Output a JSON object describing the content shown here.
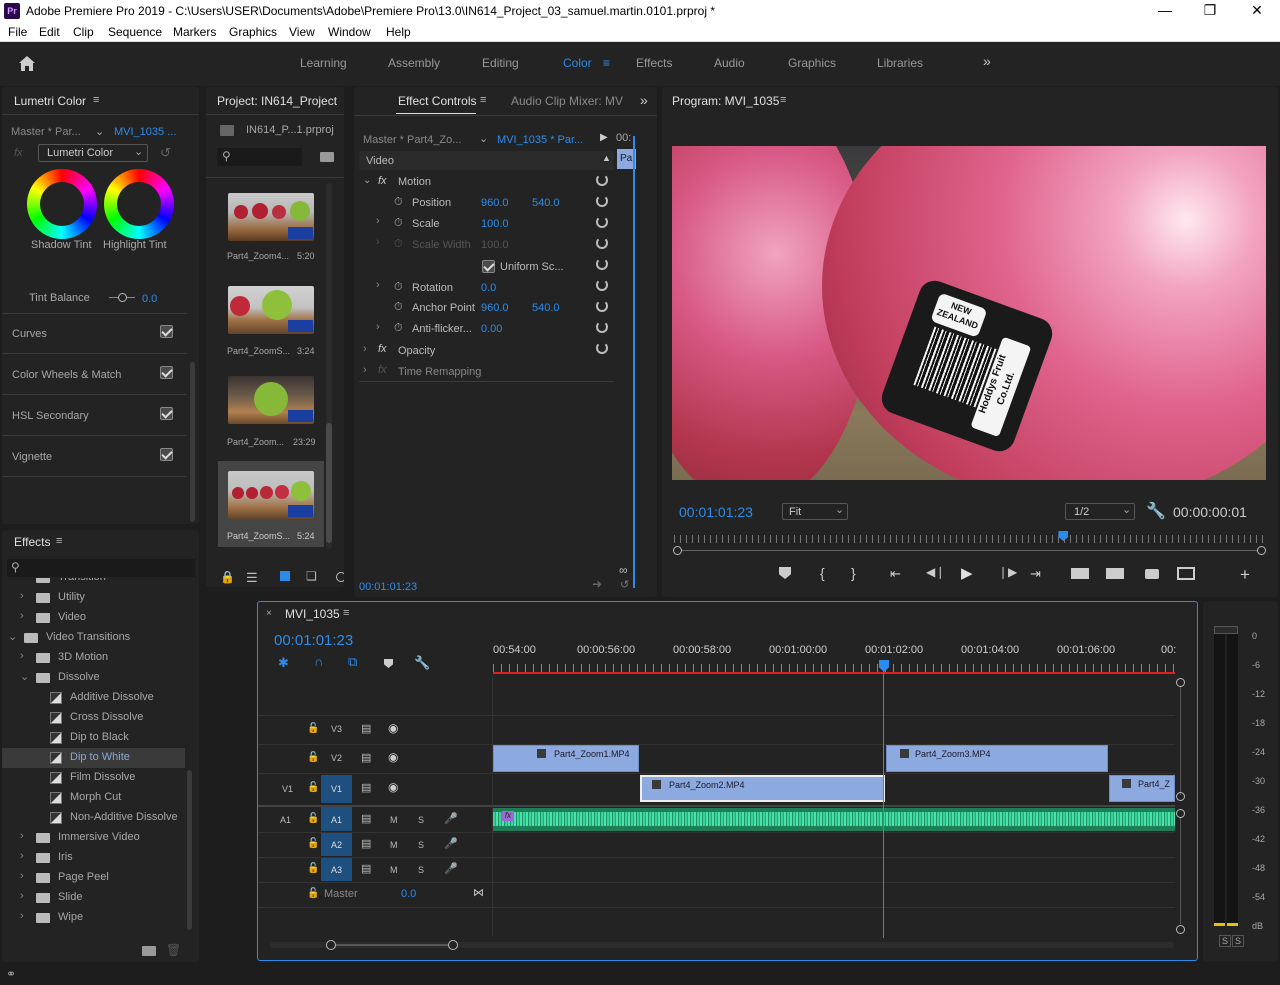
{
  "window": {
    "title": "Adobe Premiere Pro 2019 - C:\\Users\\USER\\Documents\\Adobe\\Premiere Pro\\13.0\\IN614_Project_03_samuel.martin.0101.prproj *",
    "app_icon": "Pr"
  },
  "menu": [
    "File",
    "Edit",
    "Clip",
    "Sequence",
    "Markers",
    "Graphics",
    "View",
    "Window",
    "Help"
  ],
  "workspaces": [
    "Learning",
    "Assembly",
    "Editing",
    "Color",
    "Effects",
    "Audio",
    "Graphics",
    "Libraries"
  ],
  "active_workspace": "Color",
  "lumetri": {
    "title": "Lumetri Color",
    "master": "Master * Par...",
    "clip": "MVI_1035 ...",
    "effect_select": "Lumetri Color",
    "wheel1": "Shadow Tint",
    "wheel2": "Highlight Tint",
    "tint_balance_label": "Tint Balance",
    "tint_balance_value": "0.0",
    "sections": [
      "Curves",
      "Color Wheels & Match",
      "HSL Secondary",
      "Vignette"
    ]
  },
  "project": {
    "title": "Project: IN614_Project",
    "file": "IN614_P...1.prproj",
    "clips": [
      {
        "name": "Part4_Zoom4...",
        "duration": "5:20"
      },
      {
        "name": "Part4_ZoomS...",
        "duration": "3:24"
      },
      {
        "name": "Part4_Zoom...",
        "duration": "23:29"
      },
      {
        "name": "Part4_ZoomS...",
        "duration": "5:24"
      }
    ]
  },
  "effect_controls": {
    "tab1": "Effect Controls",
    "tab2": "Audio Clip Mixer: MV",
    "master": "Master * Part4_Zo...",
    "clip": "MVI_1035 * Par...",
    "time_label": "00:",
    "clip_marker": "Pa",
    "section": "Video",
    "motion": "Motion",
    "position_label": "Position",
    "position_x": "960.0",
    "position_y": "540.0",
    "scale_label": "Scale",
    "scale_value": "100.0",
    "scale_width_label": "Scale Width",
    "scale_width_value": "100.0",
    "uniform_label": "Uniform Sc...",
    "rotation_label": "Rotation",
    "rotation_value": "0.0",
    "anchor_label": "Anchor Point",
    "anchor_x": "960.0",
    "anchor_y": "540.0",
    "antiflicker_label": "Anti-flicker...",
    "antiflicker_value": "0.00",
    "opacity": "Opacity",
    "time_remap": "Time Remapping",
    "timecode": "00:01:01:23"
  },
  "program": {
    "title": "Program: MVI_1035",
    "timecode": "00:01:01:23",
    "fit": "Fit",
    "resolution": "1/2",
    "duration": "00:00:00:01",
    "playhead_pos": 0.66,
    "sticker_line1": "NEW",
    "sticker_line2": "ZEALAND",
    "sticker_brand": "Hoddys Fruit Co.Ltd."
  },
  "effects": {
    "title": "Effects",
    "items": [
      {
        "label": "Transition",
        "level": 1,
        "type": "folder"
      },
      {
        "label": "Utility",
        "level": 1,
        "type": "folder"
      },
      {
        "label": "Video",
        "level": 1,
        "type": "folder"
      },
      {
        "label": "Video Transitions",
        "level": 0,
        "type": "folder"
      },
      {
        "label": "3D Motion",
        "level": 1,
        "type": "folder"
      },
      {
        "label": "Dissolve",
        "level": 1,
        "type": "folder"
      },
      {
        "label": "Additive Dissolve",
        "level": 2,
        "type": "effect"
      },
      {
        "label": "Cross Dissolve",
        "level": 2,
        "type": "effect"
      },
      {
        "label": "Dip to Black",
        "level": 2,
        "type": "effect"
      },
      {
        "label": "Dip to White",
        "level": 2,
        "type": "effect"
      },
      {
        "label": "Film Dissolve",
        "level": 2,
        "type": "effect"
      },
      {
        "label": "Morph Cut",
        "level": 2,
        "type": "effect"
      },
      {
        "label": "Non-Additive Dissolve",
        "level": 2,
        "type": "effect"
      },
      {
        "label": "Immersive Video",
        "level": 1,
        "type": "folder"
      },
      {
        "label": "Iris",
        "level": 1,
        "type": "folder"
      },
      {
        "label": "Page Peel",
        "level": 1,
        "type": "folder"
      },
      {
        "label": "Slide",
        "level": 1,
        "type": "folder"
      },
      {
        "label": "Wipe",
        "level": 1,
        "type": "folder"
      }
    ],
    "selected": "Dip to White"
  },
  "timeline": {
    "title": "MVI_1035",
    "timecode": "00:01:01:23",
    "ruler": [
      "00:54:00",
      "00:00:56:00",
      "00:00:58:00",
      "00:01:00:00",
      "00:01:02:00",
      "00:01:04:00",
      "00:01:06:00",
      "00:"
    ],
    "tracks": {
      "v3": "V3",
      "v2": "V2",
      "v1src": "V1",
      "v1": "V1",
      "a1src": "A1",
      "a1": "A1",
      "a2": "A2",
      "a3": "A3",
      "m": "M",
      "s": "S",
      "master": "Master",
      "master_value": "0.0"
    },
    "clips": {
      "v2a": "Part4_Zoom1.MP4",
      "v2b": "Part4_Zoom3.MP4",
      "v1a": "Part4_Zoom2.MP4",
      "v1b": "Part4_Z"
    },
    "fx_badge": "fx"
  },
  "meter": {
    "scale": [
      "0",
      "-6",
      "-12",
      "-18",
      "-24",
      "-30",
      "-36",
      "-42",
      "-48",
      "-54",
      "dB"
    ],
    "solo": "S"
  }
}
